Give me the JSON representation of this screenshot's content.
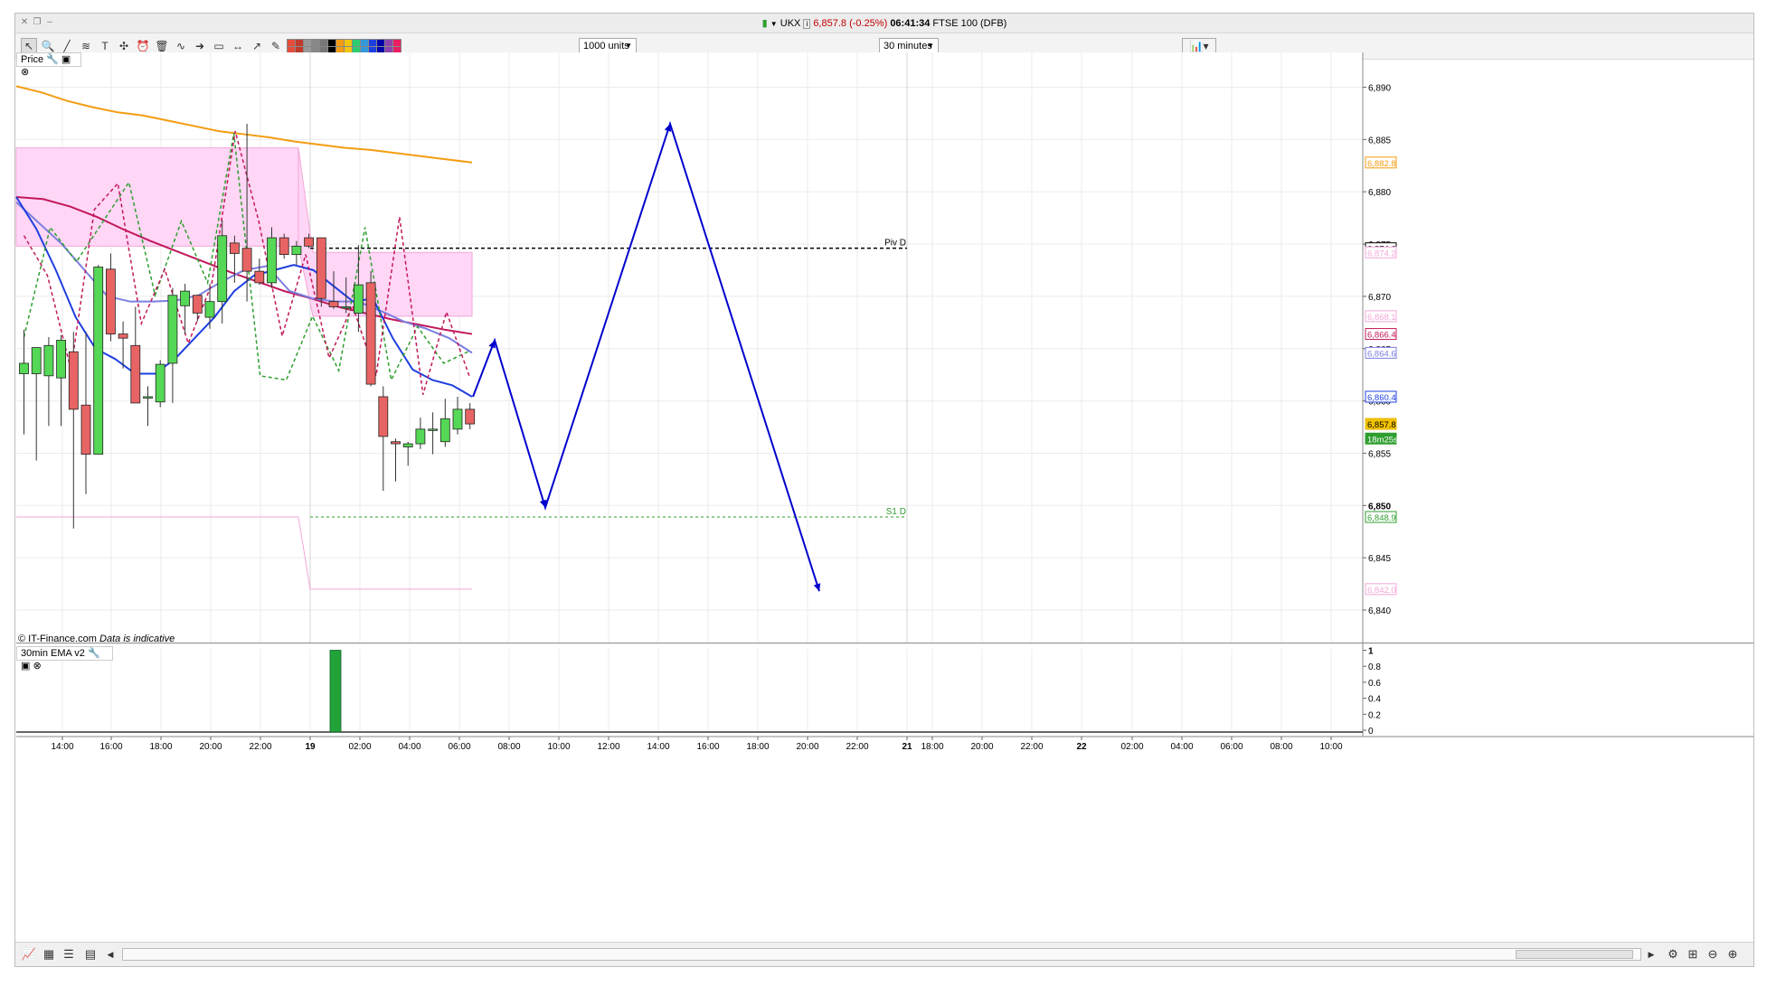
{
  "window": {
    "title": {
      "symbol": "UKX",
      "price_change": "6,857.8 (-0.25%)",
      "time": "06:41:34",
      "market": "FTSE 100 (DFB)"
    }
  },
  "toolbar": {
    "tools": [
      "pointer-icon",
      "zoom-icon",
      "draw-line-icon",
      "fibonacci-icon",
      "text-icon",
      "settings-tools-icon",
      "alarm-icon",
      "delete-icon",
      "trendline-icon",
      "arrow-icon",
      "shape-icon",
      "horizontal-line-icon",
      "ray-icon",
      "pen-icon"
    ],
    "swatches": [
      "#e74c3c",
      "#c0392b",
      "#999999",
      "#888888",
      "#777777",
      "#000000",
      "#f39c12",
      "#f1c40f",
      "#2ecc71",
      "#3498db",
      "#1e3fe0",
      "#0000aa",
      "#8e44ad",
      "#e91e63"
    ],
    "size_select": "1000 units",
    "interval_select": "30 minutes"
  },
  "price_panel": {
    "label": "Price",
    "copyright": "© IT-Finance.com",
    "disclaimer": "Data is indicative",
    "y_ticks": [
      "6,890",
      "6,885",
      "6,880",
      "6,875",
      "6,870",
      "6,865",
      "6,860",
      "6,855",
      "6,850",
      "6,845",
      "6,840"
    ],
    "pivot_label": "Piv D",
    "s1_label": "S1 D",
    "price_tags": [
      {
        "text": "6,882.8",
        "value": 6882.8,
        "color": "#f39c12"
      },
      {
        "text": "6,874.6",
        "value": 6874.6,
        "color": "#000000"
      },
      {
        "text": "6,874.2",
        "value": 6874.2,
        "color": "#f2a7d8"
      },
      {
        "text": "6,868.1",
        "value": 6868.1,
        "color": "#f2a7d8"
      },
      {
        "text": "6,866.4",
        "value": 6866.4,
        "color": "#c2185b"
      },
      {
        "text": "6,864.6",
        "value": 6864.6,
        "color": "#7b7fe0"
      },
      {
        "text": "6,860.4",
        "value": 6860.4,
        "color": "#1e3fe0"
      },
      {
        "text": "6,857.8",
        "value": 6857.8,
        "color": "#e8b800"
      },
      {
        "text": "18m25s",
        "value": 6856.4,
        "color": "#2e9e2e"
      },
      {
        "text": "6,848.9",
        "value": 6848.9,
        "color": "#2e9e2e"
      },
      {
        "text": "6,842.0",
        "value": 6842.0,
        "color": "#f2a7d8"
      }
    ]
  },
  "indicator_panel": {
    "label": "30min EMA v2",
    "y_ticks": [
      "1",
      "0.8",
      "0.6",
      "0.4",
      "0.2",
      "0"
    ],
    "bar_value": 1
  },
  "x_axis": {
    "labels": [
      "14:00",
      "16:00",
      "18:00",
      "20:00",
      "22:00",
      "19",
      "02:00",
      "04:00",
      "06:00",
      "08:00",
      "10:00",
      "12:00",
      "14:00",
      "16:00",
      "18:00",
      "20:00",
      "22:00",
      "21",
      "18:00",
      "20:00",
      "22:00",
      "22",
      "02:00",
      "04:00",
      "06:00",
      "08:00",
      "10:00"
    ],
    "bold": [
      "19",
      "21",
      "22"
    ]
  },
  "chart_data": {
    "type": "candlestick",
    "instrument": "UKX",
    "interval": "30 minutes",
    "ylim": [
      6836.5,
      6893
    ],
    "candles": [
      {
        "o": 6862.6,
        "h": 6866.8,
        "l": 6856.8,
        "c": 6863.6
      },
      {
        "o": 6862.6,
        "h": 6865.1,
        "l": 6854.3,
        "c": 6865.1
      },
      {
        "o": 6862.4,
        "h": 6866.1,
        "l": 6857.6,
        "c": 6865.3
      },
      {
        "o": 6862.2,
        "h": 6866.3,
        "l": 6857.6,
        "c": 6865.8
      },
      {
        "o": 6864.7,
        "h": 6866.6,
        "l": 6847.8,
        "c": 6859.2
      },
      {
        "o": 6859.6,
        "h": 6866.6,
        "l": 6851.1,
        "c": 6854.9
      },
      {
        "o": 6854.9,
        "h": 6873.0,
        "l": 6854.9,
        "c": 6872.8
      },
      {
        "o": 6872.6,
        "h": 6874.1,
        "l": 6865.7,
        "c": 6866.4
      },
      {
        "o": 6866.4,
        "h": 6867.6,
        "l": 6863.1,
        "c": 6866.0
      },
      {
        "o": 6865.3,
        "h": 6869.0,
        "l": 6860.4,
        "c": 6859.8
      },
      {
        "o": 6860.4,
        "h": 6861.4,
        "l": 6857.6,
        "c": 6860.4
      },
      {
        "o": 6859.9,
        "h": 6863.9,
        "l": 6859.4,
        "c": 6863.5
      },
      {
        "o": 6863.6,
        "h": 6870.8,
        "l": 6859.8,
        "c": 6870.1
      },
      {
        "o": 6869.1,
        "h": 6871.2,
        "l": 6866.4,
        "c": 6870.5
      },
      {
        "o": 6870.1,
        "h": 6870.1,
        "l": 6867.6,
        "c": 6868.4
      },
      {
        "o": 6868.0,
        "h": 6871.2,
        "l": 6866.9,
        "c": 6869.5
      },
      {
        "o": 6869.5,
        "h": 6877.3,
        "l": 6867.4,
        "c": 6875.8
      },
      {
        "o": 6875.1,
        "h": 6875.8,
        "l": 6871.3,
        "c": 6874.1
      },
      {
        "o": 6874.6,
        "h": 6886.5,
        "l": 6869.5,
        "c": 6872.4
      },
      {
        "o": 6872.4,
        "h": 6873.6,
        "l": 6871.1,
        "c": 6871.3
      },
      {
        "o": 6871.3,
        "h": 6876.6,
        "l": 6870.8,
        "c": 6875.6
      },
      {
        "o": 6875.6,
        "h": 6876.0,
        "l": 6873.6,
        "c": 6874.0
      },
      {
        "o": 6874.0,
        "h": 6875.3,
        "l": 6873.0,
        "c": 6874.8
      },
      {
        "o": 6875.6,
        "h": 6876.0,
        "l": 6874.6,
        "c": 6874.8
      },
      {
        "o": 6875.6,
        "h": 6875.6,
        "l": 6869.0,
        "c": 6869.8
      },
      {
        "o": 6869.5,
        "h": 6872.4,
        "l": 6868.8,
        "c": 6869.0
      },
      {
        "o": 6869.0,
        "h": 6871.8,
        "l": 6868.4,
        "c": 6869.0
      },
      {
        "o": 6868.4,
        "h": 6874.9,
        "l": 6866.6,
        "c": 6871.1
      },
      {
        "o": 6871.3,
        "h": 6872.4,
        "l": 6861.4,
        "c": 6861.6
      },
      {
        "o": 6860.4,
        "h": 6861.4,
        "l": 6851.4,
        "c": 6856.6
      },
      {
        "o": 6856.1,
        "h": 6856.4,
        "l": 6852.3,
        "c": 6855.9
      },
      {
        "o": 6855.6,
        "h": 6856.1,
        "l": 6853.8,
        "c": 6855.9
      },
      {
        "o": 6855.9,
        "h": 6858.4,
        "l": 6855.4,
        "c": 6857.3
      },
      {
        "o": 6857.3,
        "h": 6858.9,
        "l": 6854.9,
        "c": 6857.3
      },
      {
        "o": 6856.1,
        "h": 6860.2,
        "l": 6855.6,
        "c": 6858.3
      },
      {
        "o": 6857.3,
        "h": 6860.4,
        "l": 6856.8,
        "c": 6859.2
      },
      {
        "o": 6859.2,
        "h": 6859.8,
        "l": 6857.3,
        "c": 6857.8
      }
    ],
    "series": [
      {
        "name": "",
        "color": "#f39c12",
        "values": [
          6890.1,
          6889.5,
          6888.7,
          6888.1,
          6887.6,
          6887.3,
          6886.8,
          6886.3,
          6885.8,
          6885.5,
          6885.2,
          6884.8,
          6884.5,
          6884.2,
          6884.0,
          6883.7,
          6883.4,
          6883.1,
          6882.8
        ]
      },
      {
        "name": "",
        "color": "#c2185b",
        "values": [
          6879.5,
          6879.3,
          6878.6,
          6877.6,
          6876.4,
          6875.3,
          6874.3,
          6873.3,
          6872.3,
          6871.4,
          6870.5,
          6869.8,
          6869.0,
          6868.4,
          6867.8,
          6867.3,
          6866.8,
          6866.4
        ]
      },
      {
        "name": "",
        "color": "#7b7fe0",
        "values": [
          6879.0,
          6877.0,
          6875.0,
          6872.5,
          6870.0,
          6869.5,
          6869.5,
          6869.6,
          6870.1,
          6871.4,
          6872.5,
          6872.9,
          6870.5,
          6869.8,
          6869.5,
          6869.5,
          6868.6,
          6867.6,
          6866.9,
          6866.0,
          6864.6
        ]
      },
      {
        "name": "",
        "color": "#1e3fe0",
        "values": [
          6879.5,
          6876.5,
          6872.5,
          6868.0,
          6865.0,
          6864.0,
          6862.6,
          6862.6,
          6864.0,
          6866.0,
          6868.0,
          6870.5,
          6872.0,
          6872.5,
          6873.0,
          6872.5,
          6871.0,
          6869.5,
          6869.8,
          6866.0,
          6863.0,
          6862.0,
          6861.5,
          6860.4
        ]
      },
      {
        "name": "",
        "color": "#2e9e2e",
        "dashed": true,
        "values": [
          6866.1,
          6876.6,
          6873.3,
          6877.1,
          6880.9,
          6870.1,
          6877.2,
          6871.3,
          6885.6,
          6862.4,
          6862.0,
          6868.1,
          6862.9,
          6876.6,
          6862.0,
          6867.1,
          6863.6,
          6864.8
        ]
      },
      {
        "name": "",
        "color": "#c2185b",
        "dashed": true,
        "values": [
          6875.8,
          6872.0,
          6863.0,
          6878.3,
          6880.8,
          6867.4,
          6872.6,
          6865.5,
          6871.2,
          6885.8,
          6877.2,
          6866.2,
          6874.0,
          6864.1,
          6869.1,
          6862.4,
          6877.6,
          6860.6,
          6868.5,
          6862.2
        ]
      },
      {
        "name": "",
        "color": "#0000cc",
        "projection": true,
        "values": [
          6860.4,
          6865.8,
          6849.8,
          6886.5,
          6841.8
        ]
      }
    ],
    "levels": [
      {
        "label": "Piv D",
        "value": 6874.6,
        "color": "#000000"
      },
      {
        "label": "S1 D",
        "value": 6848.9,
        "color": "#2e9e2e"
      }
    ],
    "band": {
      "upper": [
        6884.2,
        6874.2
      ],
      "lower": [
        6874.8,
        6868.1
      ],
      "color": "#ffd6f5"
    },
    "band_lines": [
      6848.9,
      6842.0
    ],
    "grid": true
  }
}
